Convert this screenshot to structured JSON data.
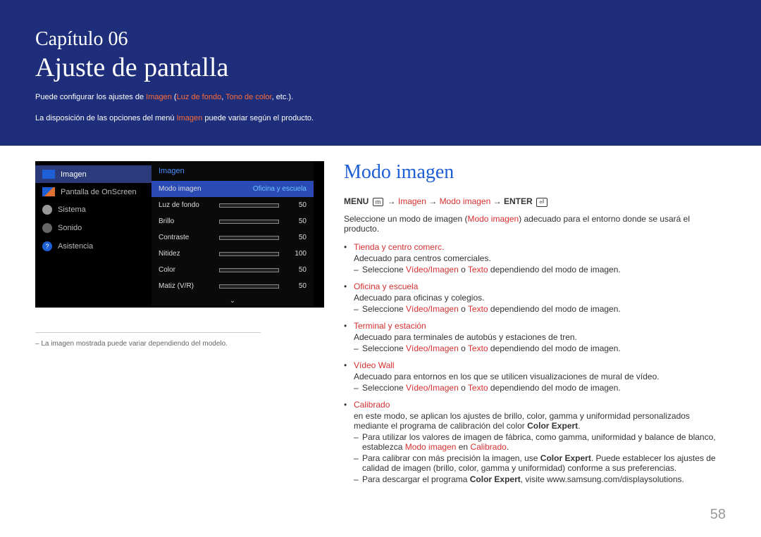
{
  "banner": {
    "chapter": "Capítulo 06",
    "title": "Ajuste de pantalla",
    "intro_pre": "Puede configurar los ajustes de ",
    "intro_k1": "Imagen",
    "intro_mid": " (",
    "intro_k2": "Luz de fondo",
    "intro_sep": ", ",
    "intro_k3": "Tono de color",
    "intro_post": ", etc.).",
    "intro2_pre": "La disposición de las opciones del menú ",
    "intro2_k": "Imagen",
    "intro2_post": " puede variar según el producto."
  },
  "nav": {
    "items": [
      {
        "label": "Imagen",
        "icon": "blue",
        "sel": true
      },
      {
        "label": "Pantalla de OnScreen",
        "icon": "scr"
      },
      {
        "label": "Sistema",
        "icon": "gear"
      },
      {
        "label": "Sonido",
        "icon": "spk"
      },
      {
        "label": "Asistencia",
        "icon": "q"
      }
    ]
  },
  "sub": {
    "header": "Imagen",
    "selected": {
      "label": "Modo imagen",
      "value": "Oficina y escuela"
    },
    "rows": [
      {
        "label": "Luz de fondo",
        "value": "50",
        "pct": 50
      },
      {
        "label": "Brillo",
        "value": "50",
        "pct": 50
      },
      {
        "label": "Contraste",
        "value": "50",
        "pct": 50
      },
      {
        "label": "Nitidez",
        "value": "100",
        "pct": 100
      },
      {
        "label": "Color",
        "value": "50",
        "pct": 50
      },
      {
        "label": "Matiz (V/R)",
        "value": "50",
        "pct": 50
      }
    ]
  },
  "note": "– La imagen mostrada puede variar dependiendo del modelo.",
  "section": {
    "title": "Modo imagen",
    "path": {
      "menu": "MENU",
      "seg1": "Imagen",
      "seg2": "Modo imagen",
      "enter": "ENTER"
    },
    "desc_pre": "Seleccione un modo de imagen (",
    "desc_hl": "Modo imagen",
    "desc_post": ") adecuado para el entorno donde se usará el producto.",
    "modes": [
      {
        "name": "Tienda y centro comerc.",
        "desc": "Adecuado para centros comerciales.",
        "sel": {
          "pre": "Seleccione ",
          "h1": "Vídeo/Imagen",
          "mid": " o ",
          "h2": "Texto",
          "post": " dependiendo del modo de imagen."
        }
      },
      {
        "name": "Oficina y escuela",
        "desc": "Adecuado para oficinas y colegios.",
        "sel": {
          "pre": "Seleccione ",
          "h1": "Vídeo/Imagen",
          "mid": " o ",
          "h2": "Texto",
          "post": " dependiendo del modo de imagen."
        }
      },
      {
        "name": "Terminal y estación",
        "desc": "Adecuado para terminales de autobús y estaciones de tren.",
        "sel": {
          "pre": "Seleccione ",
          "h1": "Vídeo/Imagen",
          "mid": " o ",
          "h2": "Texto",
          "post": " dependiendo del modo de imagen."
        }
      },
      {
        "name": "Vídeo Wall",
        "desc": "Adecuado para entornos en los que se utilicen visualizaciones de mural de vídeo.",
        "sel": {
          "pre": "Seleccione ",
          "h1": "Vídeo/Imagen",
          "mid": " o ",
          "h2": "Texto",
          "post": " dependiendo del modo de imagen."
        }
      }
    ],
    "calibrado": {
      "name": "Calibrado",
      "desc": "en este modo, se aplican los ajustes de brillo, color, gamma y uniformidad personalizados mediante el programa de calibración del color Color Expert.",
      "b1_pre": "Para utilizar los valores de imagen de fábrica, como gamma, uniformidad y balance de blanco, establezca ",
      "b1_h1": "Modo imagen",
      "b1_mid": " en ",
      "b1_h2": "Calibrado",
      "b1_post": ".",
      "b2": "Para calibrar con más precisión la imagen, use Color Expert. Puede establecer los ajustes de calidad de imagen (brillo, color, gamma y uniformidad) conforme a sus preferencias.",
      "b3": "Para descargar el programa Color Expert, visite www.samsung.com/displaysolutions."
    }
  },
  "page": "58"
}
